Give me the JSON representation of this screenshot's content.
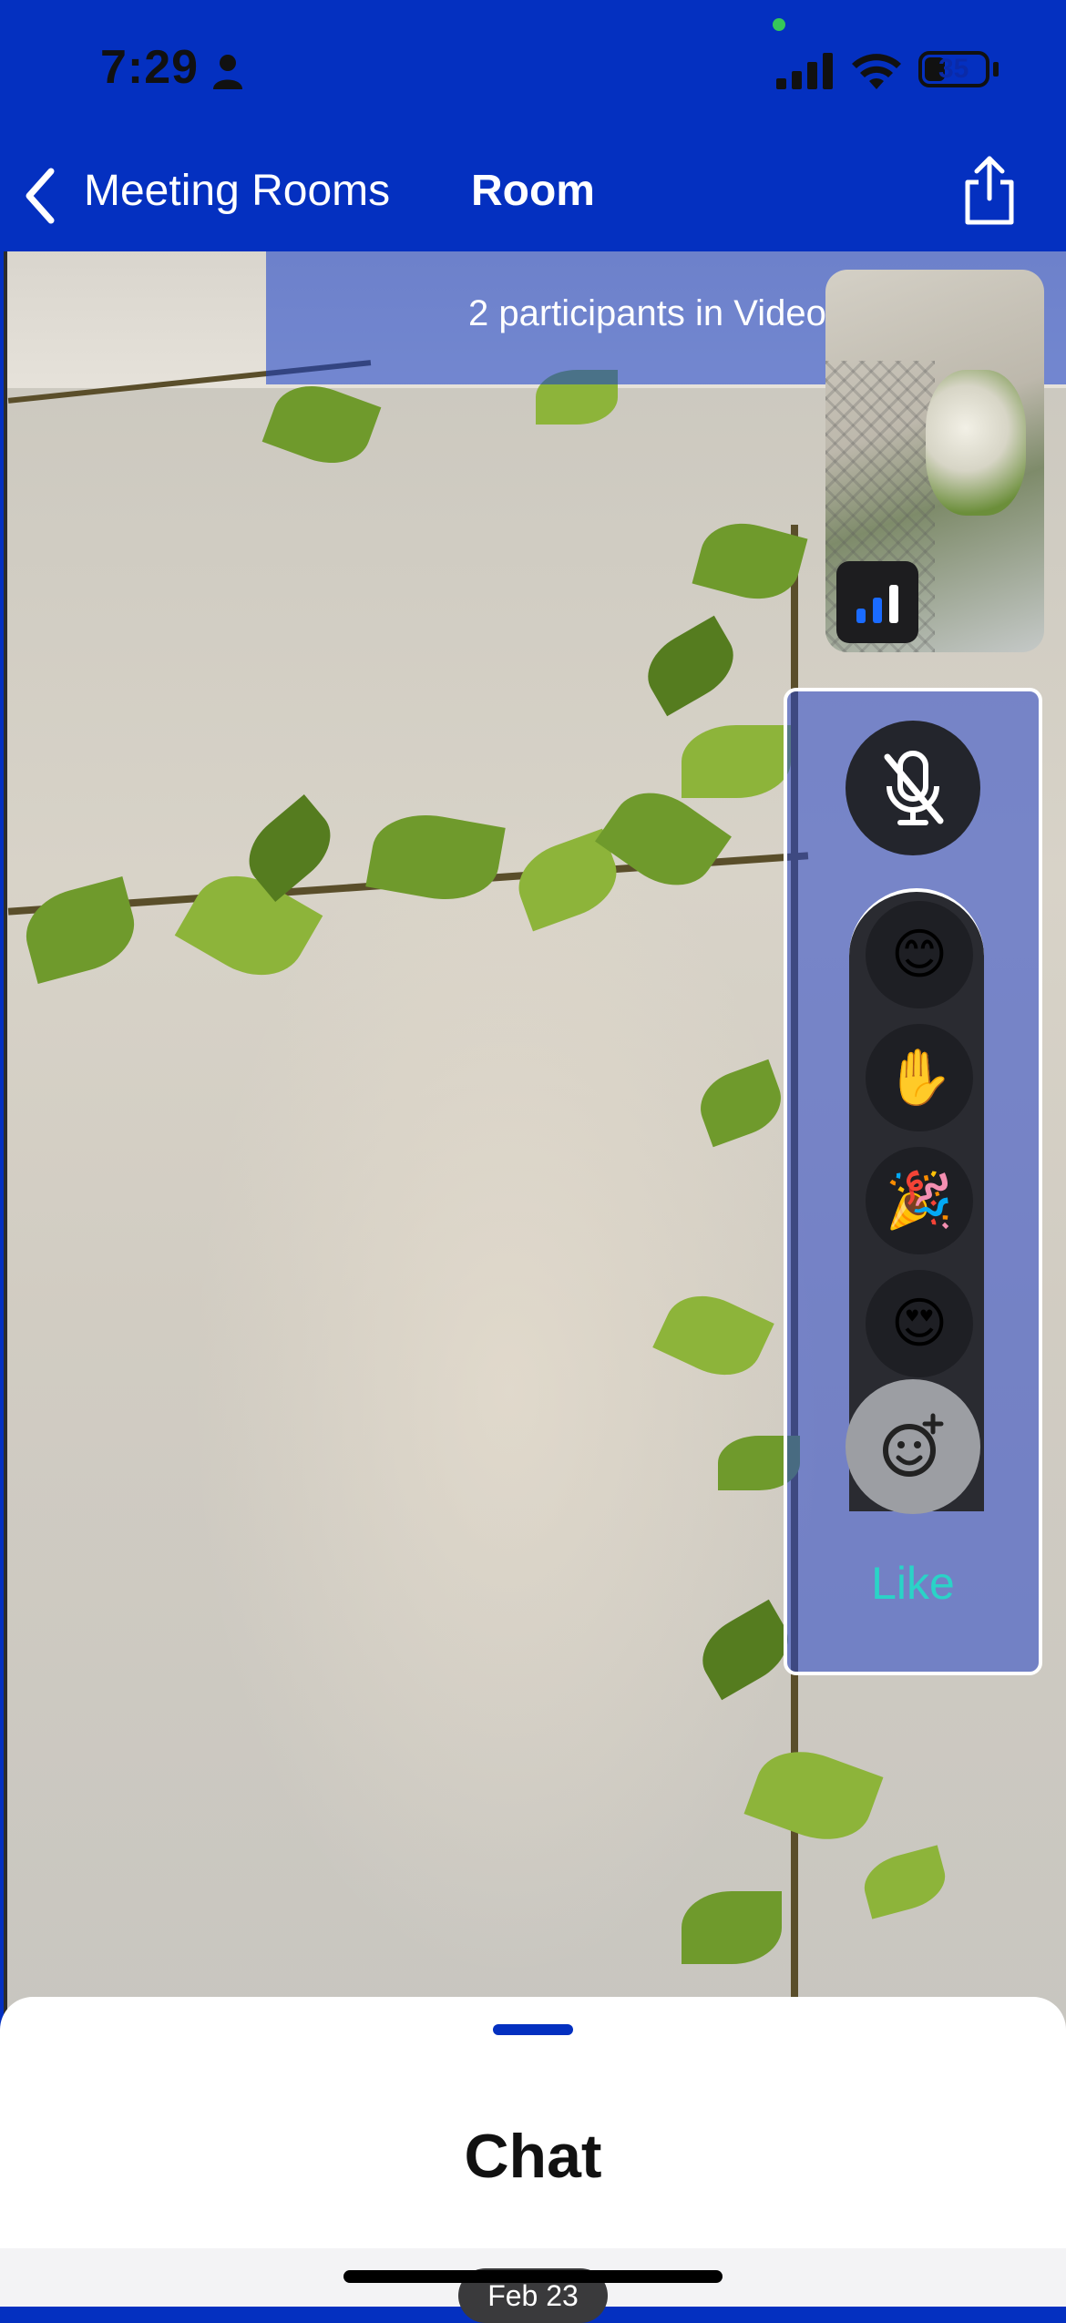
{
  "status_bar": {
    "time": "7:29",
    "battery": "35"
  },
  "nav": {
    "back_label": "Meeting Rooms",
    "title": "Room"
  },
  "banner": {
    "text": "2 participants in Video"
  },
  "controls": {
    "reactions": [
      {
        "name": "smile",
        "emoji": "😊"
      },
      {
        "name": "raised-hand",
        "emoji": "✋"
      },
      {
        "name": "party-popper",
        "emoji": "🎉"
      },
      {
        "name": "heart-eyes",
        "emoji": "😍"
      }
    ],
    "like_label": "Like"
  },
  "sheet": {
    "title": "Chat",
    "date": "Feb 23"
  }
}
